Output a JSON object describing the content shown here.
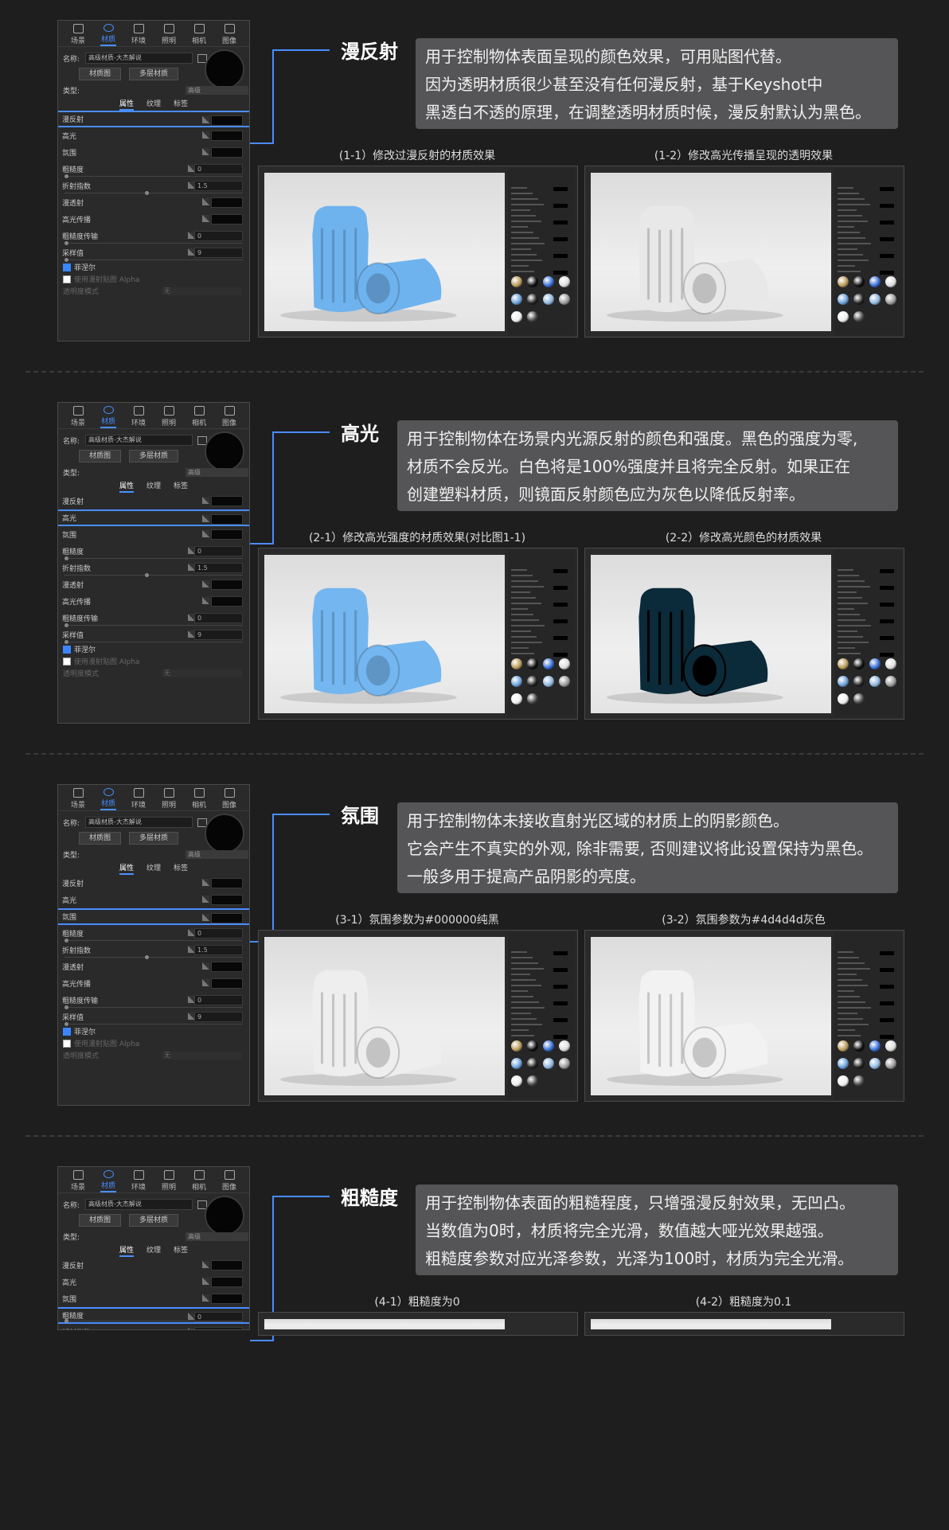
{
  "panel": {
    "tabs": [
      "场景",
      "材质",
      "环境",
      "照明",
      "相机",
      "图像"
    ],
    "name_label": "名称:",
    "name_value": "高级材质-大杰解说",
    "btn_material_map": "材质图",
    "btn_multi_material": "多层材质",
    "type_label": "类型:",
    "type_value": "高级",
    "subtabs": [
      "属性",
      "纹理",
      "标签"
    ],
    "params": {
      "diffuse": "漫反射",
      "specular": "高光",
      "ambient": "氛围",
      "roughness": "粗糙度",
      "roughness_value": "0",
      "ior": "折射指数",
      "ior_value": "1.5",
      "diffuse_transmission": "漫透射",
      "specular_transmission": "高光传播",
      "roughness_transmission": "粗糙度传输",
      "roughness_transmission_value": "0",
      "samples": "采样值",
      "samples_value": "9",
      "fresnel": "菲涅尔",
      "use_alpha": "使用漫射贴图 Alpha",
      "transparency_mode": "透明度模式",
      "transparency_mode_value": "无"
    }
  },
  "sections": [
    {
      "heading": "漫反射",
      "lines": [
        "用于控制物体表面呈现的颜色效果，可用贴图代替。",
        "因为透明材质很少甚至没有任何漫反射，基于Keyshot中",
        "黑透白不透的原理，在调整透明材质时候，漫反射默认为黑色。"
      ],
      "caption_left": "(1-1）修改过漫反射的材质效果",
      "caption_right": "(1-2）修改高光传播呈现的透明效果",
      "colors": [
        "#6fb3ee",
        "#e8e8e8"
      ]
    },
    {
      "heading": "高光",
      "lines": [
        "用于控制物体在场景内光源反射的颜色和强度。黑色的强度为零,",
        "材质不会反光。白色将是100%强度并且将完全反射。如果正在",
        "创建塑料材质，则镜面反射颜色应为灰色以降低反射率。"
      ],
      "caption_left": "(2-1）修改高光强度的材质效果(对比图1-1)",
      "caption_right": "(2-2）修改高光颜色的材质效果",
      "colors": [
        "#74b6f0",
        "#0b2a3a"
      ]
    },
    {
      "heading": "氛围",
      "lines": [
        "用于控制物体未接收直射光区域的材质上的阴影颜色。",
        "它会产生不真实的外观, 除非需要, 否则建议将此设置保持为黑色。",
        "一般多用于提高产品阴影的亮度。"
      ],
      "caption_left": "(3-1）氛围参数为#000000纯黑",
      "caption_right": "(3-2）氛围参数为#4d4d4d灰色",
      "colors": [
        "#eeeeee",
        "#f2f2f2"
      ]
    },
    {
      "heading": "粗糙度",
      "lines": [
        "用于控制物体表面的粗糙程度，只增强漫反射效果，无凹凸。",
        "当数值为0时，材质将完全光滑，数值越大哑光效果越强。",
        "粗糙度参数对应光泽参数，光泽为100时，材质为完全光滑。"
      ],
      "caption_left": "(4-1）粗糙度为0",
      "caption_right": "(4-2）粗糙度为0.1",
      "colors": [
        "#e0e0e0",
        "#e0e0e0"
      ]
    }
  ],
  "accent_color": "#4a8cff"
}
